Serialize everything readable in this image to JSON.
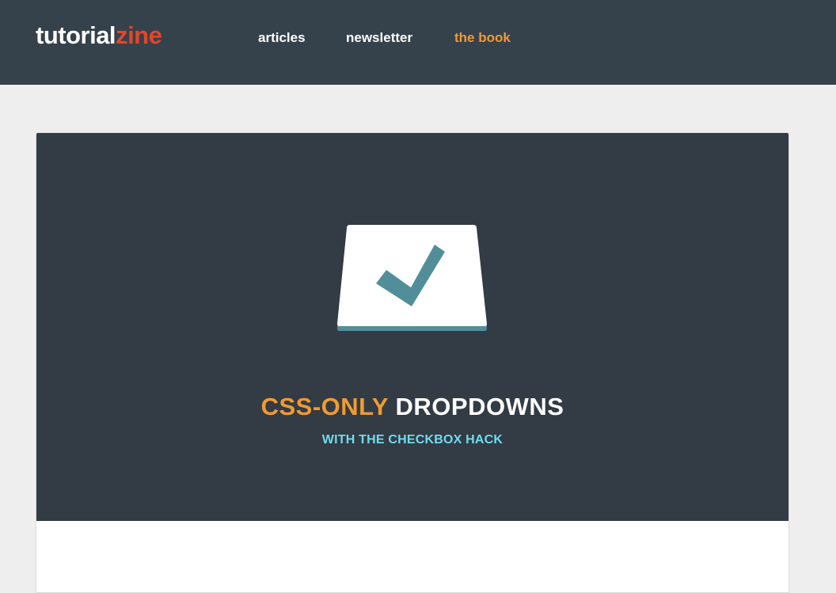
{
  "header": {
    "logo": {
      "part_a": "tutorial",
      "part_b": "zine"
    },
    "nav": [
      {
        "label": "articles",
        "color": "#ffffff"
      },
      {
        "label": "newsletter",
        "color": "#ffffff"
      },
      {
        "label": "the book",
        "color": "#ef9b34"
      }
    ]
  },
  "hero": {
    "icon": "checkbox-check-icon",
    "title_accent": "CSS-ONLY",
    "title_rest": "DROPDOWNS",
    "subtitle": "WITH THE CHECKBOX HACK"
  },
  "colors": {
    "header_bg": "#36424b",
    "hero_bg": "#333b44",
    "accent_orange": "#ef9b34",
    "logo_red": "#e0472b",
    "subtitle_cyan": "#6fdcef",
    "check_teal": "#528e99"
  }
}
